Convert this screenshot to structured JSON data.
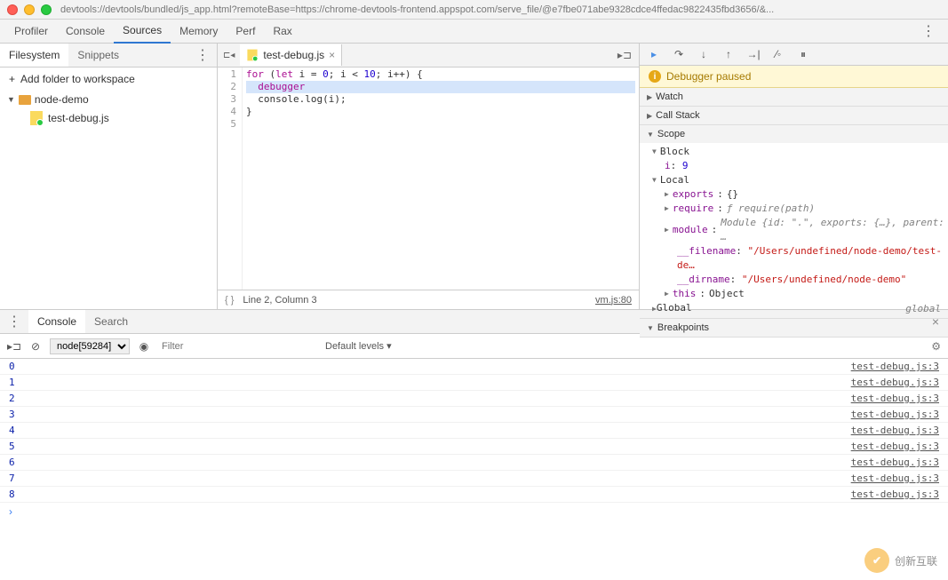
{
  "titlebar": {
    "url": "devtools://devtools/bundled/js_app.html?remoteBase=https://chrome-devtools-frontend.appspot.com/serve_file/@e7fbe071abe9328cdce4ffedac9822435fbd3656/&..."
  },
  "main_tabs": [
    "Profiler",
    "Console",
    "Sources",
    "Memory",
    "Perf",
    "Rax"
  ],
  "left_tabs": [
    "Filesystem",
    "Snippets"
  ],
  "add_folder": "Add folder to workspace",
  "folder": "node-demo",
  "file": "test-debug.js",
  "editor_tab": "test-debug.js",
  "code_lines": [
    {
      "html": "<span class='kw'>for</span> (<span class='kw'>let</span> i = <span class='num'>0</span>; i &lt; <span class='num'>10</span>; i++) {"
    },
    {
      "html": "  <span class='kw'>debugger</span>",
      "selected": true
    },
    {
      "html": "  console.log(i);"
    },
    {
      "html": "}"
    },
    {
      "html": ""
    }
  ],
  "status": {
    "cursor": "Line 2, Column 3",
    "link": "vm.js:80"
  },
  "debugger_banner": "Debugger paused",
  "sections": {
    "watch": "Watch",
    "callstack": "Call Stack",
    "scope": "Scope",
    "breakpoints": "Breakpoints"
  },
  "scope": {
    "block": "Block",
    "i_label": "i",
    "i_val": "9",
    "local": "Local",
    "exports_label": "exports",
    "exports_val": "{}",
    "require_label": "require",
    "require_val": "ƒ require(path)",
    "module_label": "module",
    "module_val": "Module {id: \".\", exports: {…}, parent: …",
    "filename_label": "__filename",
    "filename_val": "\"/Users/undefined/node-demo/test-de…",
    "dirname_label": "__dirname",
    "dirname_val": "\"/Users/undefined/node-demo\"",
    "this_label": "this",
    "this_val": "Object",
    "global": "Global",
    "global_val": "global"
  },
  "drawer_tabs": [
    "Console",
    "Search"
  ],
  "context": "node[59284]",
  "filter_placeholder": "Filter",
  "levels": "Default levels ▾",
  "console": [
    {
      "v": "0",
      "src": "test-debug.js:3"
    },
    {
      "v": "1",
      "src": "test-debug.js:3"
    },
    {
      "v": "2",
      "src": "test-debug.js:3"
    },
    {
      "v": "3",
      "src": "test-debug.js:3"
    },
    {
      "v": "4",
      "src": "test-debug.js:3"
    },
    {
      "v": "5",
      "src": "test-debug.js:3"
    },
    {
      "v": "6",
      "src": "test-debug.js:3"
    },
    {
      "v": "7",
      "src": "test-debug.js:3"
    },
    {
      "v": "8",
      "src": "test-debug.js:3"
    }
  ],
  "watermark": "创新互联"
}
